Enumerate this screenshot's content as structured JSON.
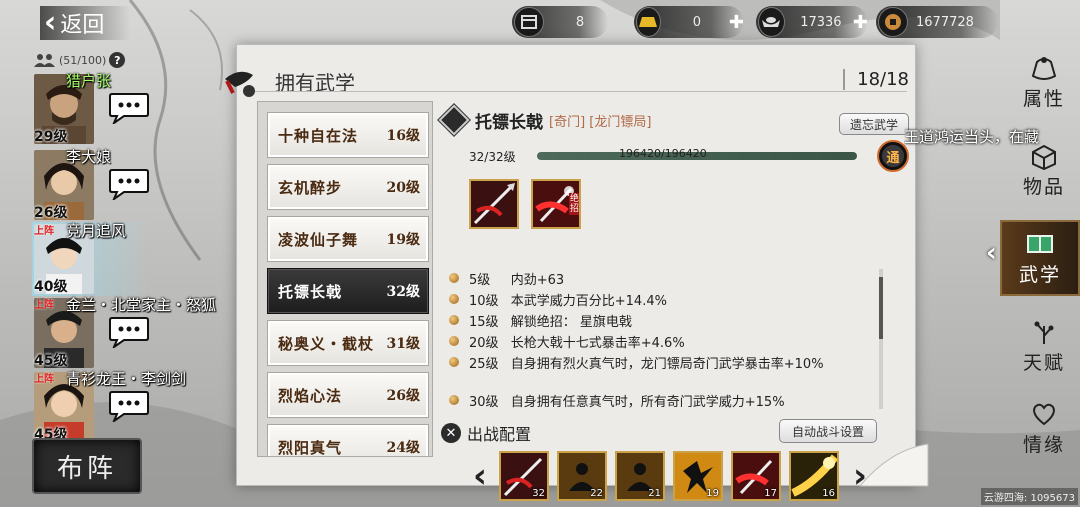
{
  "nav": {
    "back_label": "返回"
  },
  "team": {
    "count": "(51/100)",
    "help": "?"
  },
  "roster": [
    {
      "name": "猎户张",
      "level": "29级",
      "deployed": "",
      "name_color": "green"
    },
    {
      "name": "李大娘",
      "level": "26级",
      "deployed": "",
      "name_color": "white"
    },
    {
      "name": "竞月追风",
      "level": "40级",
      "deployed": "上阵",
      "name_color": "white",
      "active": true
    },
    {
      "name": "金兰・北堂家主・怒狐",
      "level": "45级",
      "deployed": "上阵",
      "name_color": "white"
    },
    {
      "name": "青衫龙王・李剑剑",
      "level": "45级",
      "deployed": "上阵",
      "name_color": "white"
    }
  ],
  "deploy_button": "布阵",
  "currencies": [
    {
      "icon": "scroll-icon",
      "value": "8"
    },
    {
      "icon": "gold-bar-icon",
      "value": "0"
    },
    {
      "icon": "silver-ingot-icon",
      "value": "17336"
    },
    {
      "icon": "copper-coin-icon",
      "value": "1677728"
    }
  ],
  "panel": {
    "title": "拥有武学",
    "count": "18/18"
  },
  "skills": [
    {
      "name": "十种自在法",
      "level": "16级"
    },
    {
      "name": "玄机醉步",
      "level": "20级"
    },
    {
      "name": "凌波仙子舞",
      "level": "19级"
    },
    {
      "name": "托镖长戟",
      "level": "32级",
      "selected": true
    },
    {
      "name": "秘奥义・截杖",
      "level": "31级"
    },
    {
      "name": "烈焰心法",
      "level": "26级"
    },
    {
      "name": "烈阳真气",
      "level": "24级"
    }
  ],
  "detail": {
    "name": "托镖长戟",
    "tags": "[奇门] [龙门镖局]",
    "forget_label": "遗忘武学",
    "level_ratio": "32/32级",
    "exp_text": "196420/196420",
    "exp_progress": 1.0,
    "mastery_badge": "通",
    "move_ult_tag": "绝招",
    "effects": [
      {
        "level": "5级",
        "text": "内劲+63"
      },
      {
        "level": "10级",
        "text": "本武学威力百分比+14.4%"
      },
      {
        "level": "15级",
        "text": "解锁绝招：   星旗电戟"
      },
      {
        "level": "20级",
        "text": "长枪大戟十七式暴击率+4.6%"
      },
      {
        "level": "25级",
        "text": "自身拥有烈火真气时，龙门镖局奇门武学暴击率+10%"
      },
      {
        "level": "30级",
        "text": "自身拥有任意真气时，所有奇门武学威力+15%"
      }
    ]
  },
  "battle": {
    "title": "出战配置",
    "auto_label": "自动战斗设置",
    "slots": [
      {
        "icon": "spear-skill-icon",
        "count": "32"
      },
      {
        "icon": "meditation-skill-icon",
        "count": "22"
      },
      {
        "icon": "meditation-skill-icon",
        "count": "21"
      },
      {
        "icon": "dance-skill-icon",
        "count": "19"
      },
      {
        "icon": "blade-skill-icon",
        "count": "17"
      },
      {
        "icon": "golden-energy-icon",
        "count": "16"
      }
    ]
  },
  "side_menu": [
    {
      "label": "属性",
      "icon": "pouch-icon"
    },
    {
      "label": "物品",
      "icon": "box-icon"
    },
    {
      "label": "武学",
      "icon": "book-icon",
      "active": true
    },
    {
      "label": "天赋",
      "icon": "branch-icon"
    },
    {
      "label": "情缘",
      "icon": "heart-icon"
    }
  ],
  "ticker": "王道鸿运当头，在藏",
  "watermark": "云游四海: 1095673",
  "colors": {
    "accent_gold": "#c9a24a",
    "name_green": "#a6ff6e",
    "deployed_red": "#e02020",
    "tag_brown": "#b06a45"
  }
}
